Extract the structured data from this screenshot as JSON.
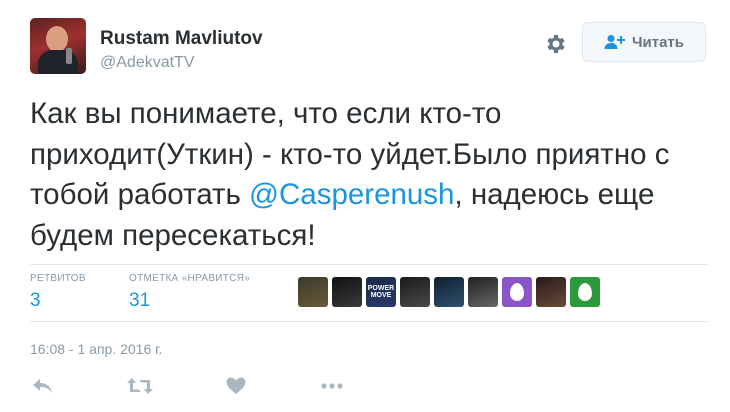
{
  "author": {
    "name": "Rustam Mavliutov",
    "handle": "@AdekvatTV"
  },
  "follow_button": {
    "label": "Читать"
  },
  "tweet": {
    "text_before": "Как вы понимаете, что если кто-то приходит(Уткин) - кто-то уйдет.Было приятно с тобой работать ",
    "mention": "@Casperenush",
    "text_after": ", надеюсь еще будем пересекаться!"
  },
  "stats": {
    "retweets_label": "РЕТВИТОВ",
    "retweets_value": "3",
    "likes_label": "ОТМЕТКА «НРАВИТСЯ»",
    "likes_value": "31"
  },
  "likers": [
    {
      "kind": "photo",
      "colors": [
        "#3a3a2a",
        "#6a5a3a"
      ]
    },
    {
      "kind": "photo",
      "colors": [
        "#111111",
        "#3a3a3a"
      ]
    },
    {
      "kind": "text",
      "text": "POWER MOVE",
      "colors": [
        "#1a2a4a",
        "#2a3a6a"
      ]
    },
    {
      "kind": "photo",
      "colors": [
        "#1a1a1a",
        "#4a4a4a"
      ]
    },
    {
      "kind": "photo",
      "colors": [
        "#102030",
        "#305070"
      ]
    },
    {
      "kind": "photo",
      "colors": [
        "#222222",
        "#666666"
      ]
    },
    {
      "kind": "egg",
      "color": "#8a55c8"
    },
    {
      "kind": "photo",
      "colors": [
        "#2a1a1a",
        "#6a4a3a"
      ]
    },
    {
      "kind": "egg",
      "color": "#2b9a3c"
    }
  ],
  "timestamp": "16:08 - 1 апр. 2016 г.",
  "icons": {
    "settings": "gear-icon",
    "follow": "add-user-icon",
    "reply": "reply-icon",
    "retweet": "retweet-icon",
    "like": "heart-icon",
    "more": "more-icon"
  },
  "colors": {
    "accent": "#1b95e0",
    "text": "#292f33",
    "muted": "#8899a6",
    "icon": "#aab8c2"
  }
}
